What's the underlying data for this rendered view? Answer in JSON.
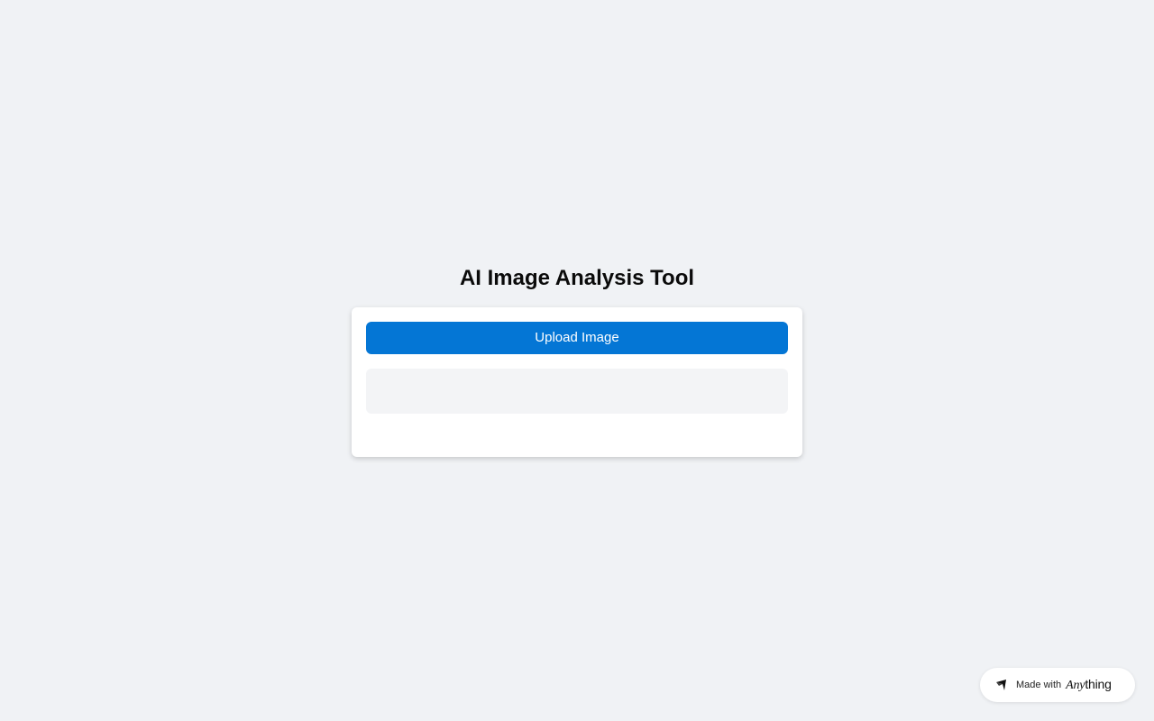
{
  "page": {
    "title": "AI Image Analysis Tool"
  },
  "card": {
    "upload_button_label": "Upload Image",
    "result_text": ""
  },
  "badge": {
    "made_with_label": "Made with",
    "brand_italic": "Any",
    "brand_rest": "thing",
    "icon": "anything-logo-icon"
  },
  "colors": {
    "background": "#f0f2f5",
    "accent": "#0476d5",
    "card": "#ffffff",
    "result_area": "#f3f4f6"
  }
}
